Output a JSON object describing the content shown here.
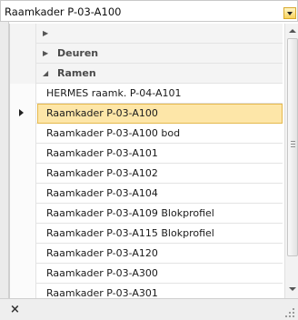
{
  "combo": {
    "value": "Raamkader P-03-A100"
  },
  "list": {
    "rows": [
      {
        "kind": "group",
        "expanded": false,
        "label": ""
      },
      {
        "kind": "group",
        "expanded": false,
        "label": "Deuren"
      },
      {
        "kind": "group",
        "expanded": true,
        "label": "Ramen"
      },
      {
        "kind": "item",
        "label": "HERMES raamk. P-04-A101"
      },
      {
        "kind": "item",
        "label": "Raamkader P-03-A100",
        "selected": true
      },
      {
        "kind": "item",
        "label": "Raamkader P-03-A100 bod"
      },
      {
        "kind": "item",
        "label": "Raamkader P-03-A101"
      },
      {
        "kind": "item",
        "label": "Raamkader P-03-A102"
      },
      {
        "kind": "item",
        "label": "Raamkader P-03-A104"
      },
      {
        "kind": "item",
        "label": "Raamkader P-03-A109 Blokprofiel"
      },
      {
        "kind": "item",
        "label": "Raamkader P-03-A115 Blokprofiel"
      },
      {
        "kind": "item",
        "label": "Raamkader P-03-A120"
      },
      {
        "kind": "item",
        "label": "Raamkader P-03-A300"
      },
      {
        "kind": "item",
        "label": "Raamkader P-03-A301"
      }
    ]
  },
  "icons": {
    "dropdown": "chevron-down-icon",
    "collapsed": "triangle-right-icon",
    "expanded": "triangle-down-icon",
    "close": "close-icon"
  },
  "footer": {
    "close_glyph": "×"
  },
  "colors": {
    "selection_fill": "#fde6a8",
    "selection_border": "#e5b94d",
    "dropdown_button": "#f7d25c"
  }
}
